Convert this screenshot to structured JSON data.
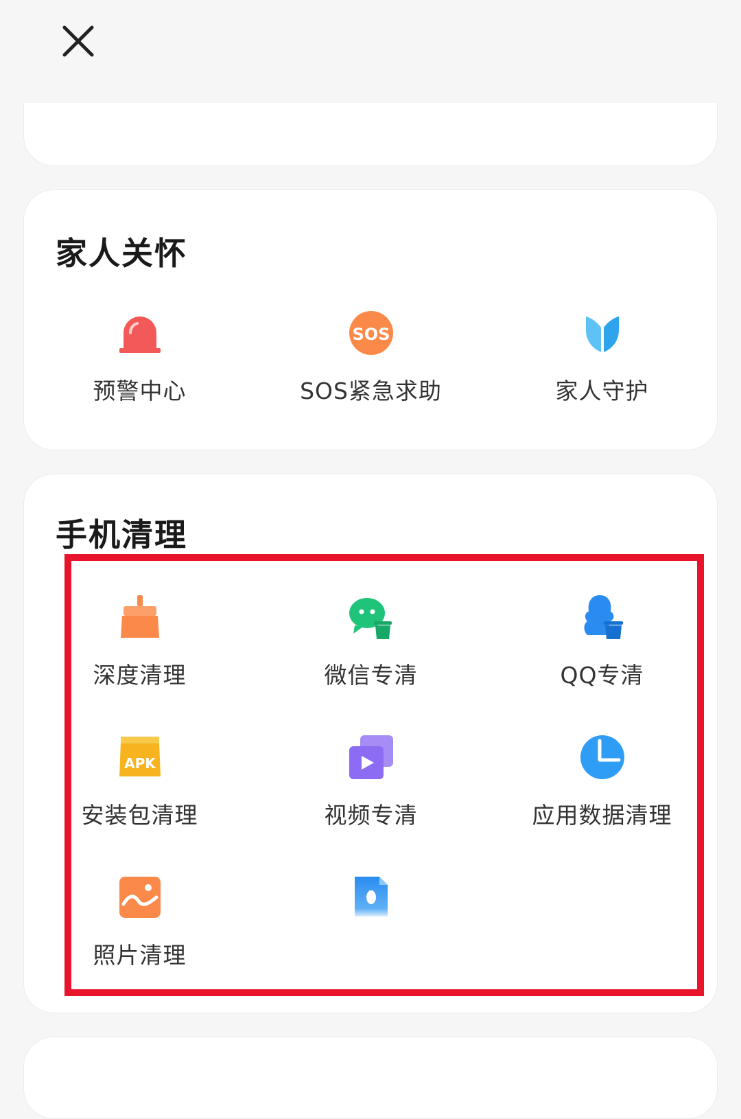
{
  "header": {
    "close_icon": "close-icon"
  },
  "family_care": {
    "title": "家人关怀",
    "items": [
      {
        "label": "预警中心",
        "icon": "alarm-icon",
        "color": "#f25a5a"
      },
      {
        "label": "SOS紧急求助",
        "icon": "sos-icon",
        "icon_text": "SOS",
        "color": "#fb8a4a"
      },
      {
        "label": "家人守护",
        "icon": "shield-icon",
        "color": "#3ab4f2"
      }
    ]
  },
  "phone_clean": {
    "title": "手机清理",
    "items": [
      {
        "label": "深度清理",
        "icon": "broom-icon",
        "color": "#fb8a4a"
      },
      {
        "label": "微信专清",
        "icon": "wechat-clean-icon",
        "color": "#1fc47a"
      },
      {
        "label": "QQ专清",
        "icon": "qq-clean-icon",
        "color": "#2a8cf0"
      },
      {
        "label": "安装包清理",
        "icon": "apk-icon",
        "icon_text": "APK",
        "color": "#f7b41f"
      },
      {
        "label": "视频专清",
        "icon": "video-icon",
        "color": "#8c6cf2"
      },
      {
        "label": "应用数据清理",
        "icon": "pie-chart-icon",
        "color": "#2f9cf5"
      },
      {
        "label": "照片清理",
        "icon": "photo-icon",
        "color": "#fb8a4a"
      },
      {
        "label": "",
        "icon": "app-clean-icon",
        "color": "#2a8cf0"
      }
    ]
  },
  "highlight_color": "#e8142c"
}
